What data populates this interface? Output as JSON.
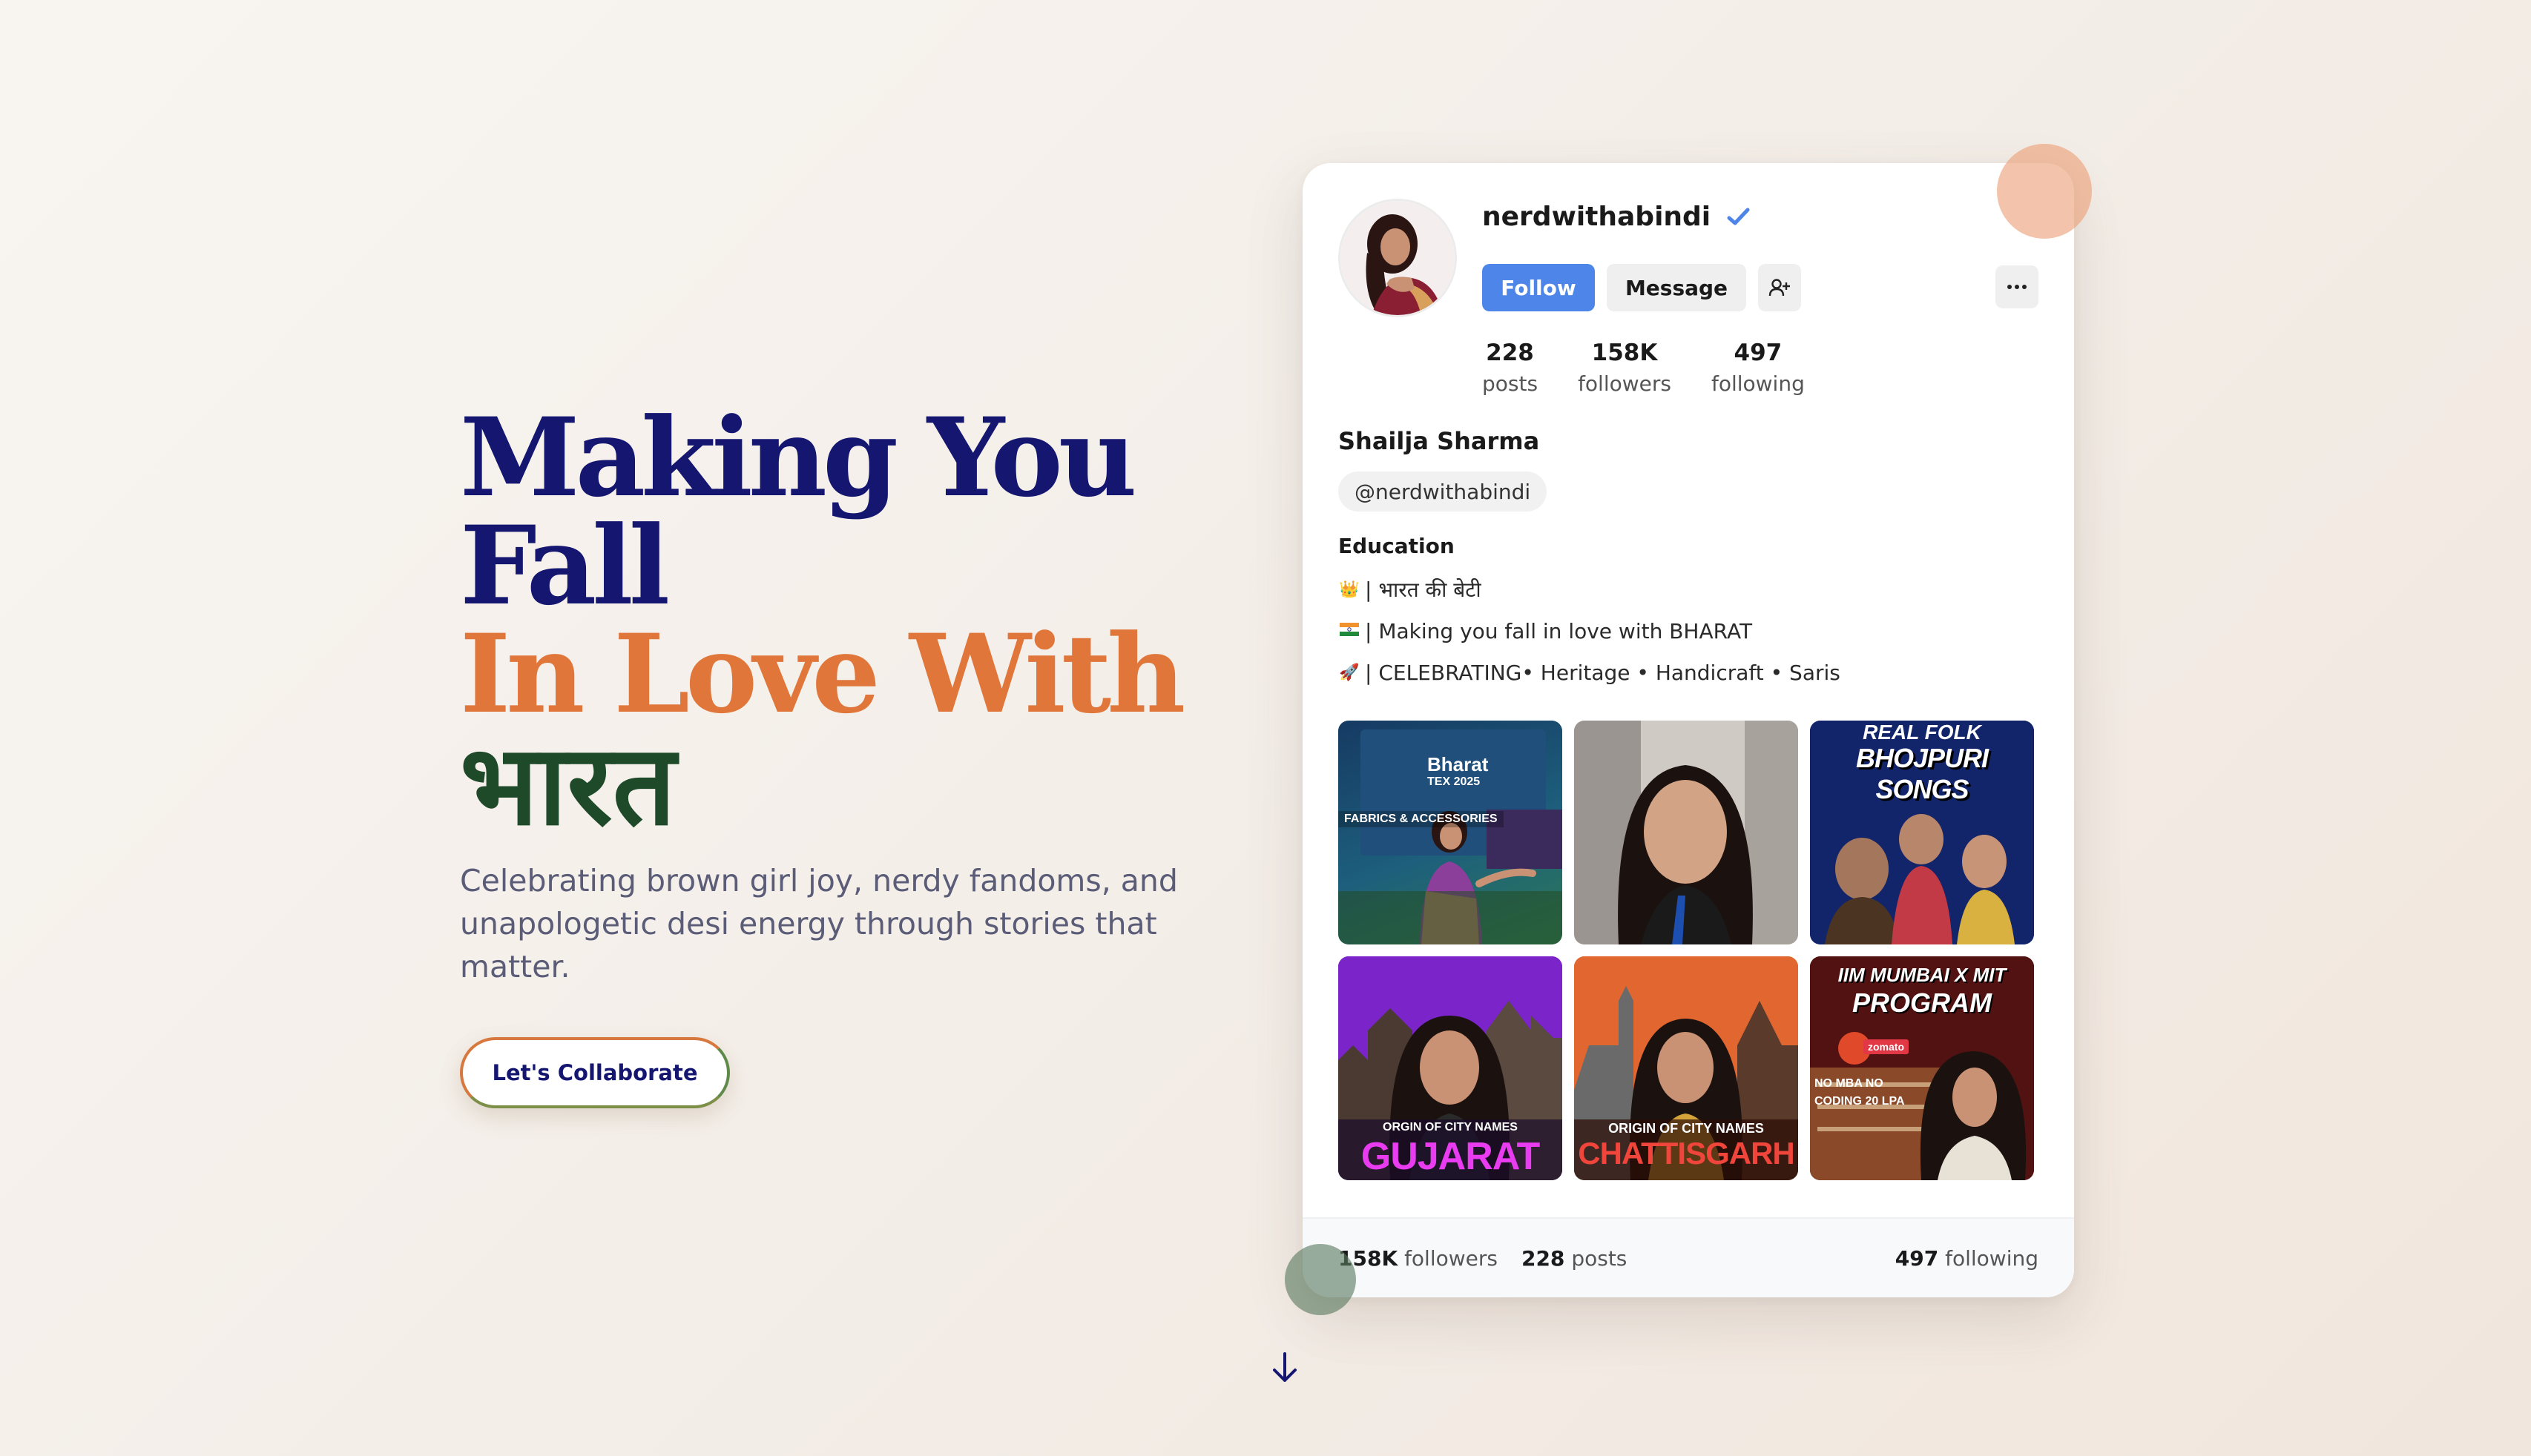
{
  "hero": {
    "title_line1": "Making You",
    "title_line2": "Fall",
    "title_line3": "In Love With",
    "title_line4": "भारत",
    "subtitle": "Celebrating brown girl joy, nerdy fandoms, and unapologetic desi energy through stories that matter.",
    "cta_label": "Let's Collaborate"
  },
  "profile": {
    "username": "nerdwithabindi",
    "follow_label": "Follow",
    "message_label": "Message",
    "stats": [
      {
        "value": "228",
        "label": "posts"
      },
      {
        "value": "158K",
        "label": "followers"
      },
      {
        "value": "497",
        "label": "following"
      }
    ],
    "full_name": "Shailja Sharma",
    "handle": "@nerdwithabindi",
    "category": "Education",
    "bio": [
      {
        "emoji": "👑",
        "text": "| भारत की बेटी"
      },
      {
        "emoji": "🇮🇳",
        "text": "| Making you fall in love with BHARAT"
      },
      {
        "emoji": "🚀",
        "text": "| CELEBRATING• Heritage • Handicraft • Saris"
      }
    ],
    "posts": [
      {
        "line1": "Bharat",
        "line2": "TEX 2025",
        "line3": "FABRICS & ACCESSORIES"
      },
      {
        "line1": "",
        "line2": "",
        "line3": ""
      },
      {
        "line1": "REAL FOLK",
        "line2": "BHOJPURI SONGS",
        "line3": ""
      },
      {
        "line1": "ORGIN OF CITY NAMES",
        "line2": "GUJARAT",
        "line3": ""
      },
      {
        "line1": "ORIGIN OF CITY NAMES",
        "line2": "CHATTISGARH",
        "line3": ""
      },
      {
        "line1": "IIM MUMBAI X MIT",
        "line2": "PROGRAM",
        "line3": "NO MBA  NO CODING  20 LPA",
        "badge": "zomato"
      }
    ],
    "footer": {
      "followers_value": "158K",
      "followers_label": "followers",
      "posts_value": "228",
      "posts_label": "posts",
      "following_value": "497",
      "following_label": "following"
    }
  },
  "colors": {
    "navy": "#141670",
    "orange": "#e0763a",
    "green": "#1f4a2a",
    "follow_blue": "#4d86e8"
  },
  "icons": [
    "verified-icon",
    "add-user-icon",
    "more-icon",
    "arrow-down-icon"
  ]
}
